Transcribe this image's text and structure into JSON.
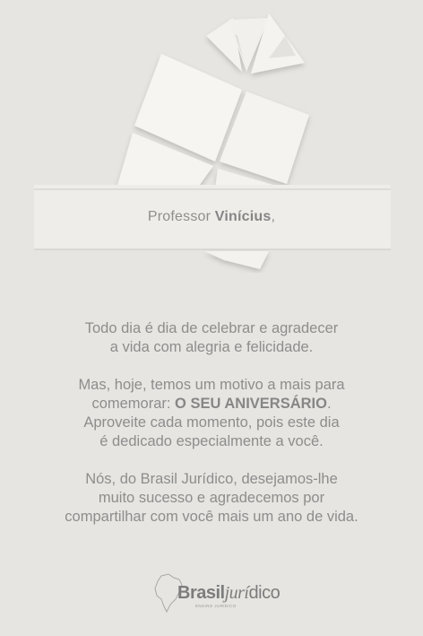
{
  "greeting": {
    "prefix": "Professor ",
    "name": "Vinícius",
    "suffix": ","
  },
  "message": {
    "p1_line1": "Todo dia é dia de celebrar e agradecer",
    "p1_line2": "a vida com alegria e felicidade.",
    "p2_line1": "Mas, hoje, temos um motivo a mais para",
    "p2_line2_prefix": "comemorar: ",
    "p2_line2_bold": "O SEU ANIVERSÁRIO",
    "p2_line2_suffix": ".",
    "p2_line3": "Aproveite cada momento, pois este dia",
    "p2_line4": "é dedicado especialmente a você.",
    "p3_line1": "Nós, do Brasil Jurídico, desejamos-lhe",
    "p3_line2": "muito sucesso e agradecemos por",
    "p3_line3": "compartilhar com você mais um ano de vida."
  },
  "logo": {
    "part_brasil": "Brasil",
    "part_juri": "jurí",
    "part_dico": "dico",
    "tagline": "ENSINO JURÍDICO"
  },
  "colors": {
    "background": "#e6e5e1",
    "paper": "#f2f1ed",
    "text": "#8d8d8d"
  }
}
